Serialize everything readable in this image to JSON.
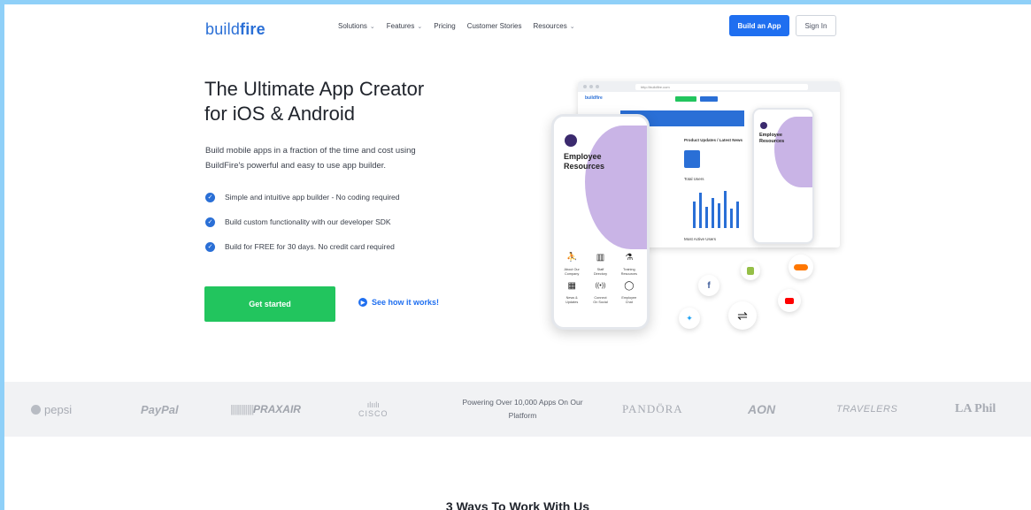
{
  "nav": {
    "logo_a": "build",
    "logo_b": "fire",
    "items": [
      {
        "label": "Solutions",
        "dropdown": true
      },
      {
        "label": "Features",
        "dropdown": true
      },
      {
        "label": "Pricing",
        "dropdown": false
      },
      {
        "label": "Customer Stories",
        "dropdown": false
      },
      {
        "label": "Resources",
        "dropdown": true
      }
    ],
    "build_button": "Build an App",
    "signin_button": "Sign In"
  },
  "hero": {
    "title_line1": "The Ultimate App Creator",
    "title_line2": "for iOS & Android",
    "subtitle_line1": "Build mobile apps in a fraction of the time and cost using",
    "subtitle_line2": "BuildFire's powerful and easy to use app builder.",
    "checks": [
      "Simple and intuitive app builder - No coding required",
      "Build custom functionality with our developer SDK",
      "Build for FREE for 30 days. No credit card required"
    ],
    "cta": "Get started",
    "how_link": "See how it works!"
  },
  "mockup": {
    "url": "http://buildfire.com",
    "phone_title_line1": "Employee",
    "phone_title_line2": "Resources",
    "phone_grid": [
      {
        "icon": "⛹",
        "label1": "About Our",
        "label2": "Company"
      },
      {
        "icon": "▥",
        "label1": "Staff",
        "label2": "Directory"
      },
      {
        "icon": "⚗",
        "label1": "Training",
        "label2": "Resources"
      },
      {
        "icon": "▦",
        "label1": "News &",
        "label2": "Updates"
      },
      {
        "icon": "((•))",
        "label1": "Connect",
        "label2": "On Social"
      },
      {
        "icon": "◯",
        "label1": "Employee",
        "label2": "Chat"
      }
    ],
    "panel_label1": "Product Updates / Latest News",
    "panel_label2": "Total Users",
    "panel_label3": "Most Active Users"
  },
  "logos": {
    "pepsi": "pepsi",
    "paypal": "PayPal",
    "praxair": "PRAXAIR",
    "cisco": "CISCO",
    "powering_line1": "Powering Over 10,000 Apps On Our",
    "powering_line2": "Platform",
    "pandora": "PANDÖRA",
    "aon": "AON",
    "travelers": "TRAVELERS",
    "laphil": "LA Phil"
  },
  "section": {
    "title": "3 Ways To Work With Us"
  },
  "colors": {
    "primary": "#1f6ff0",
    "green": "#22c55e",
    "frame": "#8fd0f8"
  }
}
